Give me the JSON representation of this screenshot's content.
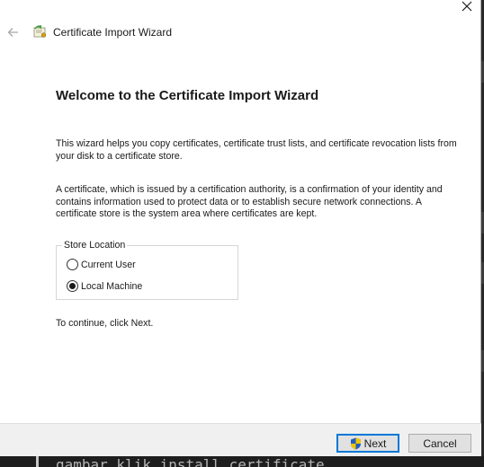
{
  "window": {
    "close_symbol": "✕",
    "title": "Certificate Import Wizard"
  },
  "page": {
    "heading": "Welcome to the Certificate Import Wizard",
    "paragraph_1": "This wizard helps you copy certificates, certificate trust lists, and certificate revocation lists from your disk to a certificate store.",
    "paragraph_2": "A certificate, which is issued by a certification authority, is a confirmation of your identity and contains information used to protect data or to establish secure network connections. A certificate store is the system area where certificates are kept.",
    "store_location": {
      "legend": "Store Location",
      "options": [
        {
          "label": "Current User",
          "selected": false
        },
        {
          "label": "Local Machine",
          "selected": true
        }
      ]
    },
    "continue_text": "To continue, click Next."
  },
  "buttons": {
    "next": "Next",
    "cancel": "Cancel"
  },
  "background": {
    "code_line": "gambar klik install certificate"
  },
  "colors": {
    "accent": "#0078d7",
    "footer_bg": "#f0f0f0",
    "text": "#1a1a1a"
  },
  "icons": {
    "back": "back-arrow-icon",
    "app": "certificate-icon",
    "close": "close-icon",
    "uac": "uac-shield-icon"
  }
}
